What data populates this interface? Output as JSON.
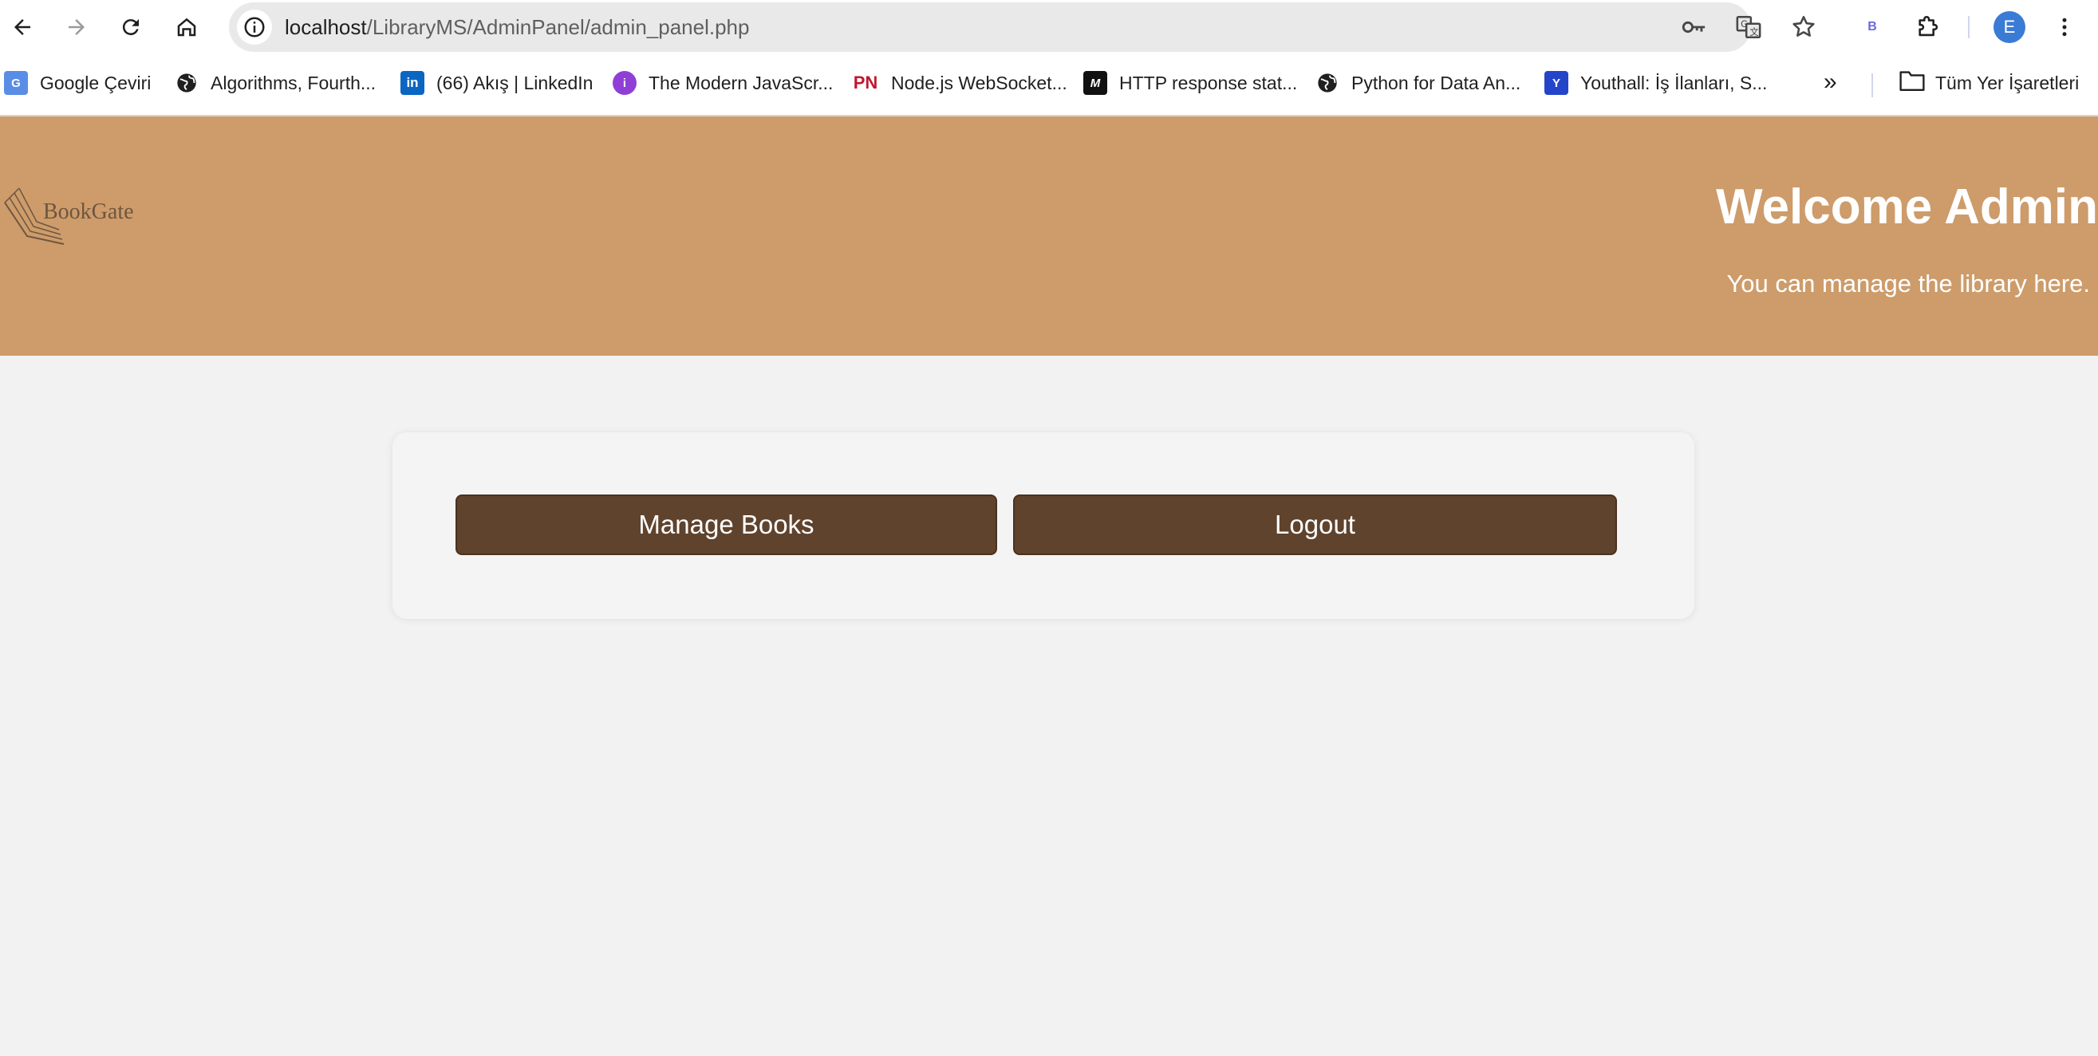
{
  "browser": {
    "url_host": "localhost",
    "url_path": "/LibraryMS/AdminPanel/admin_panel.php",
    "profile_initial": "E",
    "extension_label": "B",
    "more_bookmarks": "»"
  },
  "bookmarks": [
    {
      "label": "Google Çeviri",
      "icon": "google-translate-icon"
    },
    {
      "label": "Algorithms, Fourth...",
      "icon": "globe-icon"
    },
    {
      "label": "(66) Akış | LinkedIn",
      "icon": "linkedin-icon"
    },
    {
      "label": "The Modern JavaScr...",
      "icon": "javascript-info-icon"
    },
    {
      "label": "Node.js WebSocket...",
      "icon": "pn-icon",
      "glyph": "PN"
    },
    {
      "label": "HTTP response stat...",
      "icon": "mdn-icon",
      "glyph": "M"
    },
    {
      "label": "Python for Data An...",
      "icon": "globe-icon"
    },
    {
      "label": "Youthall: İş İlanları, S...",
      "icon": "youthall-icon",
      "glyph": "Y"
    },
    {
      "label": "Tüm Yer İşaretleri",
      "icon": "folder-icon"
    }
  ],
  "header": {
    "logo_text": "BookGate",
    "title": "Welcome Admin",
    "subtitle": "You can manage the library here."
  },
  "actions": {
    "manage_books": "Manage Books",
    "logout": "Logout"
  },
  "colors": {
    "header_bg": "#cd9c6a",
    "button_bg": "#5f432d",
    "page_bg": "#f2f2f2"
  }
}
